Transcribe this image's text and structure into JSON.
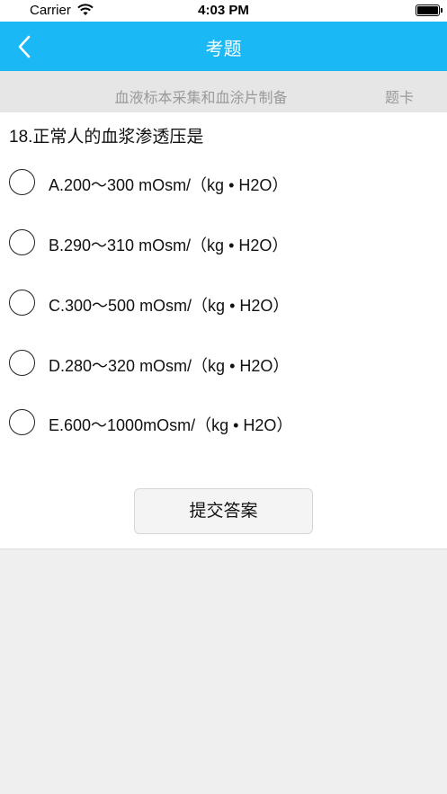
{
  "status_bar": {
    "carrier": "Carrier",
    "time": "4:03 PM"
  },
  "nav": {
    "title": "考题",
    "back_icon": "chevron-left-icon",
    "background_color": "#1ab8f5"
  },
  "subheader": {
    "chapter": "血液标本采集和血涂片制备",
    "card_label": "题卡"
  },
  "question": {
    "text": "18.正常人的血浆渗透压是",
    "options": [
      "A.200～300 mOsm/（kg • H2O）",
      "B.290～310 mOsm/（kg • H2O）",
      "C.300～500 mOsm/（kg • H2O）",
      "D.280～320 mOsm/（kg • H2O）",
      "E.600～1000mOsm/（kg • H2O）"
    ]
  },
  "submit_label": "提交答案"
}
